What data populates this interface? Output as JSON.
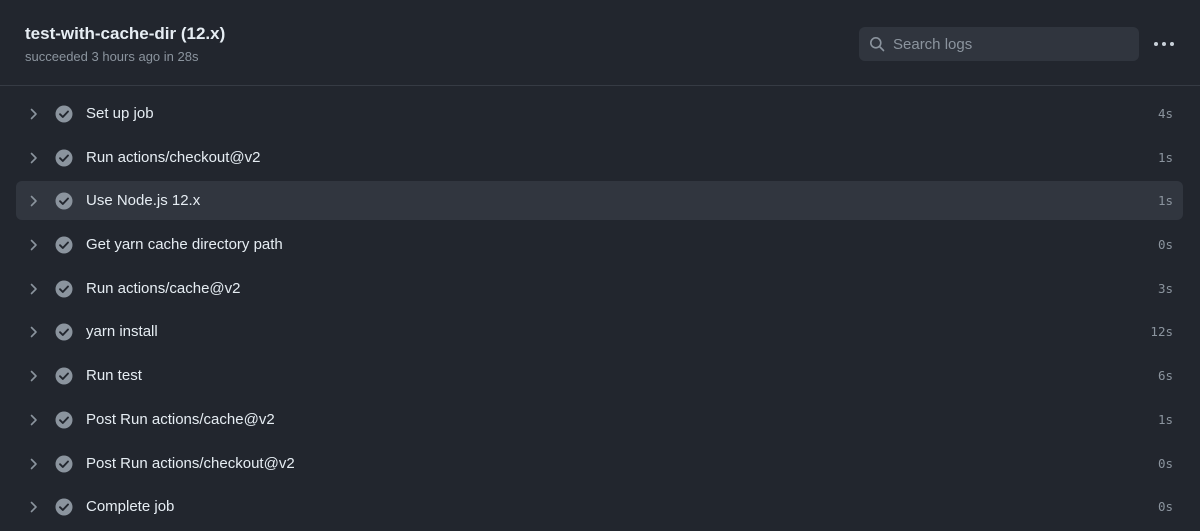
{
  "job": {
    "title": "test-with-cache-dir (12.x)",
    "status": "succeeded 3 hours ago in 28s"
  },
  "search": {
    "placeholder": "Search logs",
    "icon": "search-icon"
  },
  "menu": {
    "icon": "kebab-horizontal-icon"
  },
  "colors": {
    "background": "#22262e",
    "row_highlight": "#31363f",
    "check_fill": "#8b949e"
  },
  "steps": [
    {
      "label": "Set up job",
      "duration": "4s"
    },
    {
      "label": "Run actions/checkout@v2",
      "duration": "1s"
    },
    {
      "label": "Use Node.js 12.x",
      "duration": "1s"
    },
    {
      "label": "Get yarn cache directory path",
      "duration": "0s"
    },
    {
      "label": "Run actions/cache@v2",
      "duration": "3s"
    },
    {
      "label": "yarn install",
      "duration": "12s"
    },
    {
      "label": "Run test",
      "duration": "6s"
    },
    {
      "label": "Post Run actions/cache@v2",
      "duration": "1s"
    },
    {
      "label": "Post Run actions/checkout@v2",
      "duration": "0s"
    },
    {
      "label": "Complete job",
      "duration": "0s"
    }
  ]
}
